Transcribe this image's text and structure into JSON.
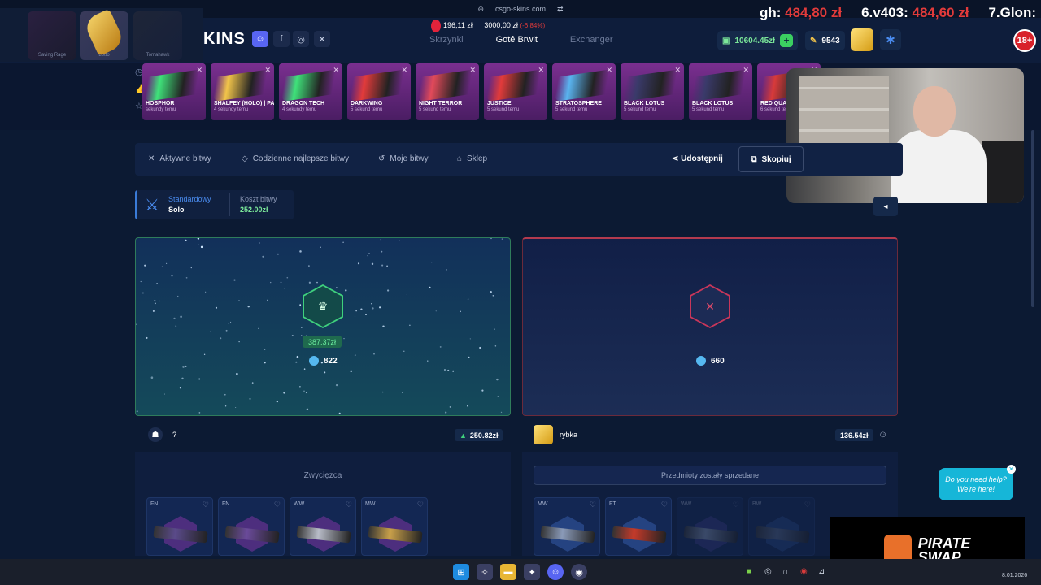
{
  "browser": {
    "url": "csgo-skins.com"
  },
  "overlay": {
    "p5_name": "gh:",
    "p5_value": "484,80 zł",
    "p6_name": "6.v403:",
    "p6_value": "484,60 zł",
    "p7_name": "7.Glon:"
  },
  "age_badge": "18+",
  "header": {
    "logo": "KINS",
    "price_main": "196,11 zł",
    "price_second": "3000,00 zł",
    "price_change": "(-6.84%)",
    "nav": [
      "Skrzynki",
      "Gotê Brwit",
      "Exchanger"
    ],
    "balance": "10604.45zł",
    "coins": "9543"
  },
  "thumbs": [
    {
      "label": "Saving Rage"
    },
    {
      "label": "Lotto"
    },
    {
      "label": "Tomahawk"
    }
  ],
  "live_feed": [
    {
      "name": "HOSPHOR",
      "time": "sekundy temu",
      "color": "#3fe27a"
    },
    {
      "name": "SHALFEY (HOLO) | PARIS 2023",
      "time": "4 sekundy temu",
      "color": "#f2c44a"
    },
    {
      "name": "DRAGON TECH",
      "time": "4 sekundy temu",
      "color": "#3fe27a"
    },
    {
      "name": "DARKWING",
      "time": "5 sekund temu",
      "color": "#e23b3b"
    },
    {
      "name": "NIGHT TERROR",
      "time": "5 sekund temu",
      "color": "#e24a5a"
    },
    {
      "name": "JUSTICE",
      "time": "5 sekund temu",
      "color": "#e23b3b"
    },
    {
      "name": "STRATOSPHERE",
      "time": "5 sekund temu",
      "color": "#5ab4f0"
    },
    {
      "name": "BLACK LOTUS",
      "time": "5 sekund temu",
      "color": "#3a3a6a"
    },
    {
      "name": "BLACK LOTUS",
      "time": "5 sekund temu",
      "color": "#3a3a6a"
    },
    {
      "name": "RED QUA",
      "time": "6 sekund temu",
      "color": "#d83a3a"
    }
  ],
  "tabs": [
    {
      "label": "Aktywne bitwy"
    },
    {
      "label": "Codzienne najlepsze bitwy"
    },
    {
      "label": "Moje bitwy"
    },
    {
      "label": "Sklep"
    }
  ],
  "share_label": "Udostępnij",
  "copy_label": "Skopiuj",
  "mode": {
    "type": "Standardowy",
    "sub": "Solo",
    "cost_label": "Koszt bitwy",
    "cost_value": "252.00zł"
  },
  "left_card": {
    "win_amount": "387.37zł",
    "gems": "822",
    "player_name": "?",
    "player_value": "250.82zł",
    "status": "Zwycięzca"
  },
  "right_card": {
    "gems": "660",
    "player_name": "rybka",
    "player_value": "136.54zł",
    "status": "Przedmioty zostały sprzedane"
  },
  "left_items": [
    {
      "cond": "FN",
      "hex": "#c33cd6",
      "gun": "#5a4a8a"
    },
    {
      "cond": "FN",
      "hex": "#c33cd6",
      "gun": "#6a4a9a"
    },
    {
      "cond": "WW",
      "hex": "#c33cd6",
      "gun": "#b8bcc8"
    },
    {
      "cond": "MW",
      "hex": "#c33cd6",
      "gun": "#c9a04a"
    }
  ],
  "right_items": [
    {
      "cond": "MW",
      "hex": "#4a7adf",
      "gun": "#8a9ab8"
    },
    {
      "cond": "FT",
      "hex": "#4a7adf",
      "gun": "#c43a2a"
    },
    {
      "cond": "WW",
      "hex": "#7a5adf",
      "gun": "#8a9ab8"
    },
    {
      "cond": "BW",
      "hex": "#4a7adf",
      "gun": "#5a6a8a"
    }
  ],
  "help": {
    "line1": "Do you need help?",
    "line2": "We're here!"
  },
  "sponsor": {
    "line1": "PIRATE",
    "line2": "SWAP"
  },
  "taskbar": {
    "date": "8.01.2026"
  }
}
